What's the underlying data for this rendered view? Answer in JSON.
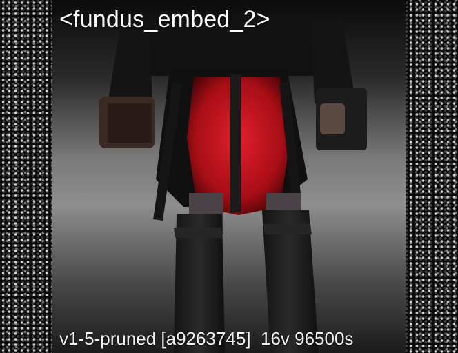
{
  "preview": {
    "title": "<fundus_embed_2>",
    "footer": "v1-5-pruned [a9263745]  16v 96500s"
  },
  "colors": {
    "text": "#ffffff",
    "accent_red": "#c8141c",
    "background": "#000000"
  }
}
